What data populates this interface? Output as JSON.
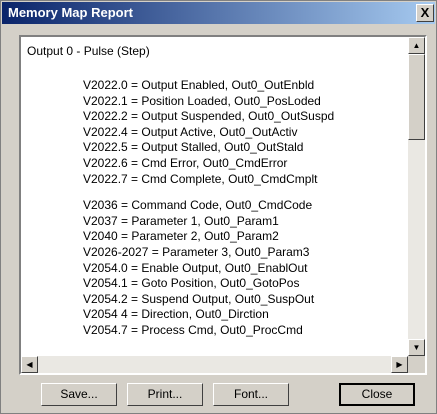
{
  "window": {
    "title": "Memory Map Report",
    "close_glyph": "X"
  },
  "report": {
    "heading": "Output 0 - Pulse (Step)",
    "group1": [
      "V2022.0 = Output Enabled, Out0_OutEnbld",
      "V2022.1 = Position Loaded, Out0_PosLoded",
      "V2022.2 = Output Suspended, Out0_OutSuspd",
      "V2022.4 = Output Active, Out0_OutActiv",
      "V2022.5 = Output Stalled, Out0_OutStald",
      "V2022.6 = Cmd Error, Out0_CmdError",
      "V2022.7 = Cmd Complete, Out0_CmdCmplt"
    ],
    "group2": [
      "V2036 = Command Code, Out0_CmdCode",
      "V2037 = Parameter 1, Out0_Param1",
      "V2040 = Parameter 2, Out0_Param2",
      "V2026-2027 = Parameter 3, Out0_Param3",
      "V2054.0 = Enable Output, Out0_EnablOut",
      "V2054.1 = Goto Position, Out0_GotoPos",
      "V2054.2 = Suspend Output, Out0_SuspOut",
      "V2054 4 = Direction, Out0_Dirction",
      "V2054.7 = Process Cmd, Out0_ProcCmd"
    ]
  },
  "buttons": {
    "save": "Save...",
    "print": "Print...",
    "font": "Font...",
    "close": "Close"
  },
  "icons": {
    "scroll_up": "up-arrow-icon",
    "scroll_down": "down-arrow-icon",
    "scroll_left": "left-arrow-icon",
    "scroll_right": "right-arrow-icon"
  },
  "colors": {
    "titlebar_start": "#0a246a",
    "titlebar_end": "#a6caf0",
    "dialog_face": "#d4d0c8"
  }
}
